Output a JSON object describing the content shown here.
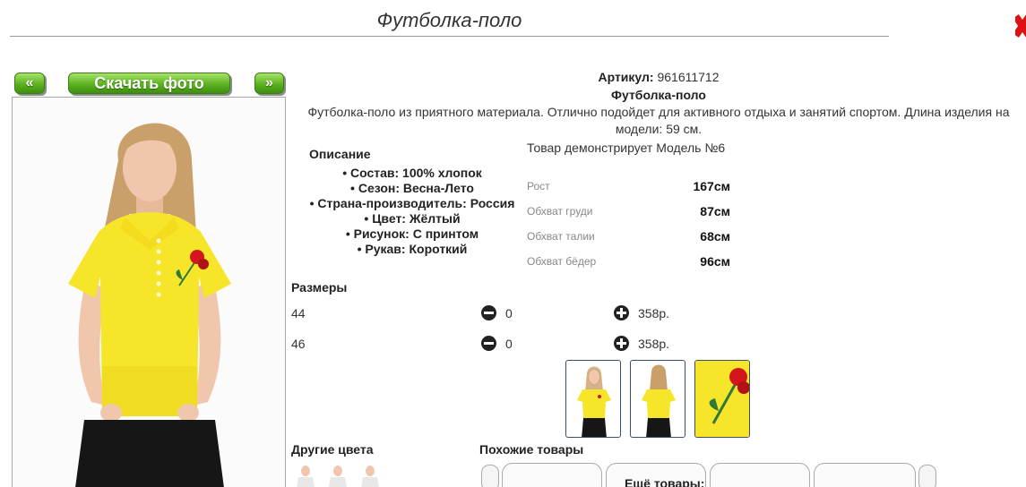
{
  "page": {
    "title": "Футболка-поло"
  },
  "gallery": {
    "prev_label": "«",
    "download_label": "Скачать фото",
    "next_label": "»"
  },
  "product": {
    "sku_label": "Артикул:",
    "sku": "961611712",
    "name": "Футболка-поло",
    "description": "Футболка-поло из приятного материала. Отлично подойдет для активного отдыха и занятий спортом. Длина изделия на модели: 59 см."
  },
  "details": {
    "title": "Описание",
    "items": [
      "Состав: 100% хлопок",
      "Сезон: Весна-Лето",
      "Страна-производитель: Россия",
      "Цвет: Жёлтый",
      "Рисунок: С принтом",
      "Рукав: Короткий"
    ]
  },
  "model": {
    "title": "Товар демонстрирует Модель №6",
    "measurements": [
      {
        "label": "Рост",
        "value": "167см"
      },
      {
        "label": "Обхват груди",
        "value": "87см"
      },
      {
        "label": "Обхват талии",
        "value": "68см"
      },
      {
        "label": "Обхват бёдер",
        "value": "96см"
      }
    ]
  },
  "sizes": {
    "title": "Размеры",
    "rows": [
      {
        "size": "44",
        "qty": "0",
        "price": "358р."
      },
      {
        "size": "46",
        "qty": "0",
        "price": "358р."
      }
    ]
  },
  "sections": {
    "other_colors": "Другие цвета",
    "similar": "Похожие товары",
    "more": "Ещё товары:"
  },
  "colors": {
    "shirt": "#f7e52a",
    "shirt_shadow": "#e2cc10",
    "pants": "#161616",
    "skin": "#f0c7ad",
    "hair": "#c9a06a",
    "rose": "#d3161b",
    "leaf": "#2f7a3a",
    "accent_green": "#5cb21f"
  }
}
